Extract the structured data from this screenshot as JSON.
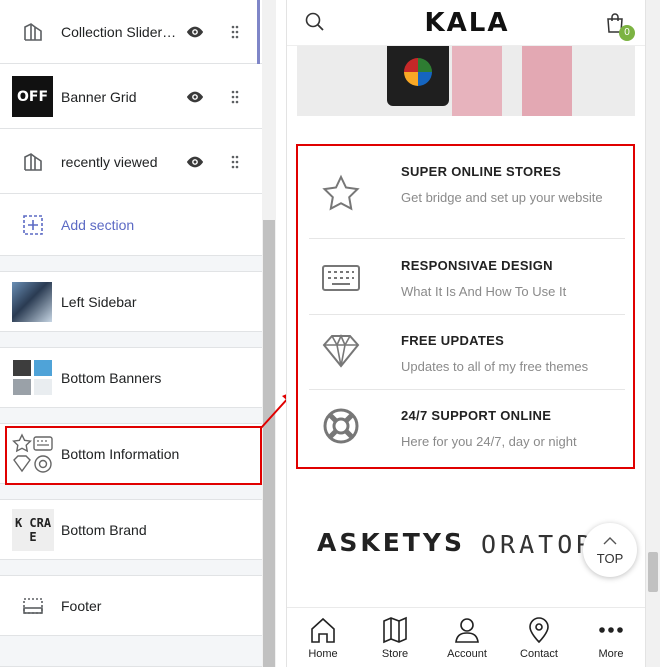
{
  "sections": [
    {
      "label": "Collection Slider…",
      "icon": "section-template-icon",
      "visible": true,
      "active": true
    },
    {
      "label": "Banner Grid",
      "icon": "banner-grid-thumbnail",
      "thumb_text": "OFF",
      "visible": true
    },
    {
      "label": "recently viewed",
      "icon": "section-template-icon",
      "visible": true
    },
    {
      "label": "Add section",
      "icon": "add-section-icon"
    },
    {
      "label": "Left Sidebar",
      "icon": "left-sidebar-thumbnail"
    },
    {
      "label": "Bottom Banners",
      "icon": "bottom-banners-thumbnail"
    },
    {
      "label": "Bottom Information",
      "icon": "bottom-information-thumbnail",
      "highlighted": true
    },
    {
      "label": "Bottom Brand",
      "icon": "bottom-brand-thumbnail",
      "thumb_text": "K CRA E"
    },
    {
      "label": "Footer",
      "icon": "footer-icon"
    }
  ],
  "preview": {
    "brand": "KALA",
    "cart_count": "0",
    "info": [
      {
        "title": "SUPER ONLINE STORES",
        "desc": "Get bridge and set up your website",
        "icon": "star-icon"
      },
      {
        "title": "RESPONSIVAE DESIGN",
        "desc": "What It Is And How To Use It",
        "icon": "keyboard-icon"
      },
      {
        "title": "FREE UPDATES",
        "desc": "Updates to all of my free themes",
        "icon": "diamond-icon"
      },
      {
        "title": "24/7 SUPPORT ONLINE",
        "desc": "Here for you 24/7, day or night",
        "icon": "lifebuoy-icon"
      }
    ],
    "brand_logos": [
      "ASKETYS",
      "ORATOR"
    ],
    "top_label": "TOP",
    "nav": [
      {
        "label": "Home",
        "icon": "home-icon"
      },
      {
        "label": "Store",
        "icon": "map-icon"
      },
      {
        "label": "Account",
        "icon": "user-icon"
      },
      {
        "label": "Contact",
        "icon": "location-pin-icon"
      },
      {
        "label": "More",
        "icon": "more-dots-icon"
      }
    ]
  },
  "colors": {
    "highlight": "#e00000",
    "accent": "#5c6ac4",
    "badge": "#7cb342"
  }
}
